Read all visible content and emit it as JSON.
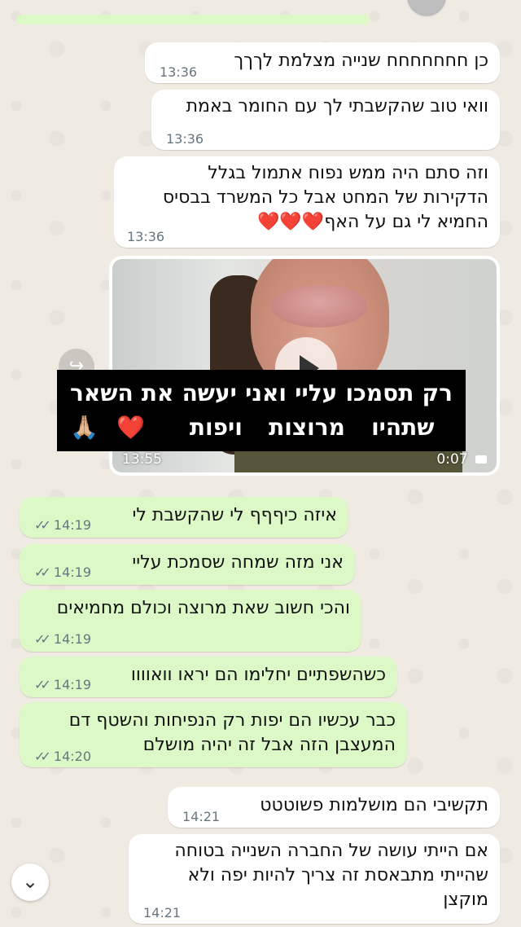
{
  "header": {
    "avatar_label": ""
  },
  "messages": [
    {
      "text": "כן חחחחחחח שנייה מצלמת לךךך",
      "time": "13:36"
    },
    {
      "text": "וואי טוב שהקשבתי לך עם החומר באמת",
      "time": "13:36"
    },
    {
      "text_lines": [
        "וזה סתם היה ממש נפוח אתמול בגלל",
        "הדקירות של המחט אבל כל המשרד בבסיס",
        "החמיא לי גם על האף❤️❤️❤️"
      ],
      "time": "13:36"
    },
    {
      "video_time": "13:55",
      "video_duration": "0:07",
      "caption": "רק תסמכו עליי ואני יעשה את השאר שתהיו מרוצות ויפות ❤️🙏🏼"
    },
    {
      "text": "איזה כיףףף לי שהקשבת לי",
      "time": "14:19"
    },
    {
      "text": "אני מזה שמחה שסמכת עליי",
      "time": "14:19"
    },
    {
      "text": "והכי חשוב שאת מרוצה וכולם מחמיאים",
      "time": "14:19"
    },
    {
      "text": "כשהשפתיים יחלימו הם יראו וואוווו",
      "time": "14:19"
    },
    {
      "text_lines": [
        "כבר עכשיו הם יפות רק הנפיחות והשטף דם",
        "המעצבן הזה אבל זה יהיה מושלם"
      ],
      "time": "14:20"
    },
    {
      "text": "תקשיבי הם מושלמות פשוטטט",
      "time": "14:21"
    },
    {
      "text_lines": [
        "אם הייתי עושה של החברה השנייה בטוחה",
        "שהייתי מתבאסת זה צריך להיות יפה ולא",
        "מוקצן"
      ],
      "time": "14:21"
    }
  ],
  "icons": {
    "read_ticks": "double-check-icon",
    "scroll_down": "chevron-down-icon",
    "forward": "forward-icon",
    "video_camera": "video-camera-icon"
  },
  "glyphs": {
    "ticks": "✓✓",
    "chevron": "⌄",
    "forward": "↪"
  },
  "colors": {
    "background": "#efeae2",
    "incoming_bubble": "#ffffff",
    "outgoing_bubble": "#dcf8c6",
    "time_text": "#667781"
  }
}
